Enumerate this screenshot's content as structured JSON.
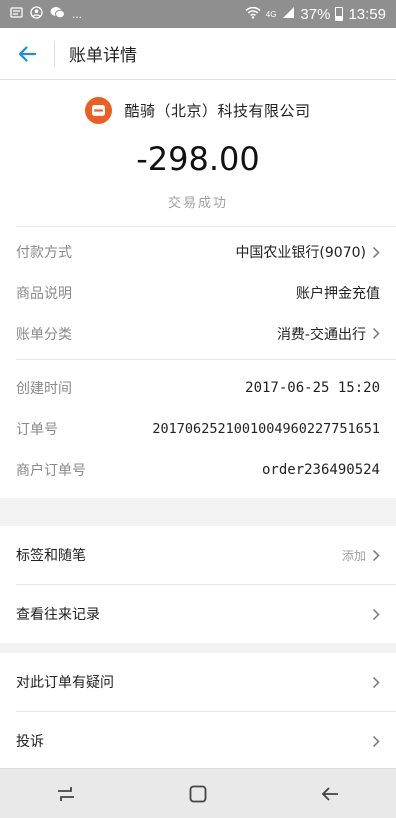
{
  "status_bar": {
    "left_icons": [
      "notification-icon",
      "account-icon",
      "wechat-icon"
    ],
    "more": "...",
    "network": "4G",
    "battery": "37%",
    "time": "13:59"
  },
  "header": {
    "title": "账单详情"
  },
  "summary": {
    "merchant_name": "酷骑（北京）科技有限公司",
    "amount": "-298.00",
    "status": "交易成功"
  },
  "details": {
    "payment_method": {
      "label": "付款方式",
      "value": "中国农业银行(9070)"
    },
    "product_desc": {
      "label": "商品说明",
      "value": "账户押金充值"
    },
    "category": {
      "label": "账单分类",
      "value": "消费-交通出行"
    },
    "created_time": {
      "label": "创建时间",
      "value": "2017-06-25 15:20"
    },
    "order_no": {
      "label": "订单号",
      "value": "20170625210010049602277516​51"
    },
    "merchant_order_no": {
      "label": "商户订单号",
      "value": "order236490524"
    }
  },
  "menu1": {
    "tags_label": "标签和随笔",
    "tags_hint": "添加",
    "history_label": "查看往来记录"
  },
  "menu2": {
    "question_label": "对此订单有疑问",
    "complaint_label": "投诉"
  },
  "colors": {
    "accent": "#1a8cf0",
    "logo": "#ec5e22",
    "status_bar": "#8f8f8f"
  }
}
